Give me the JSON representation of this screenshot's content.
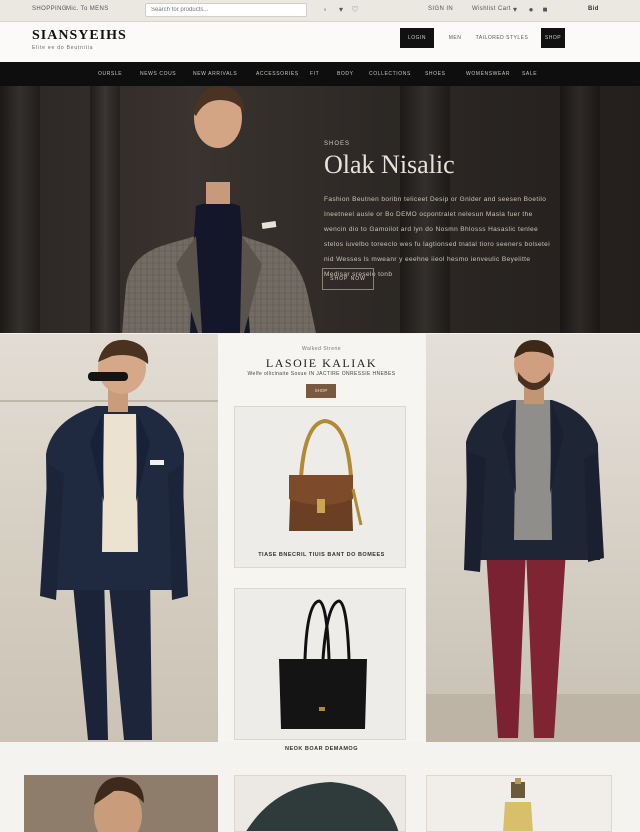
{
  "topbar": {
    "left_items": [
      "SHOPPING",
      "Mic. To MENS"
    ],
    "search_placeholder": "Search for products...",
    "icons": [
      "cart-icon",
      "chevron-down-icon",
      "heart-icon",
      "user-icon"
    ],
    "right_items": [
      "SIGN IN",
      "Wishlist Cart",
      "Bid"
    ]
  },
  "header": {
    "logo": "SIANSYEIHS",
    "tagline": "Elite ee do Beutnitia",
    "buttons": [
      "LOGIN",
      "MEN",
      "TAILORED STYLES",
      "SHOP"
    ]
  },
  "nav": {
    "items": [
      "OURSLE",
      "NEWS COUS",
      "NEW ARRIVALS",
      "ACCESSORIES",
      "FIT",
      "BODY",
      "COLLECTIONS",
      "SHOES",
      "WOMENSWEAR",
      "SALE"
    ]
  },
  "hero": {
    "eyebrow": "SHOES",
    "title": "Olak Nisalic",
    "body": "Fashion Beutnen boribn teliceet Desip or Gnlder and seesen Boetilo Ineetneel ausle or Bo DEMO ocpontralet nelesun Masla fuer the wencin dio to Gamoilot ard lyn do Nosmn Bhlosss Hasaslic tenlee stelos iuvelbo toreeclo wes fu lagtionsed tnatal tioro seeners bolsetei nid Wesses ls mweanr y eeehne iieol hesmo ienveulic Beyelitte Medisar sreselo tonb",
    "cta": "SHOP NOW"
  },
  "collection": {
    "eyebrow": "Walked Strene",
    "title": "LASOIE KALIAK",
    "subtitle": "Welfe ollicinaite Sosue IN JACTIRE ONRESSIE HNEBES",
    "button": "SHOP",
    "cards": [
      {
        "label": "TIASE BNECRIL TIUIS BANT DO BOMEES"
      },
      {
        "label": "NEOK BOAR DEMAMOG"
      }
    ]
  },
  "colors": {
    "nav_bg": "#0e0e0e",
    "hero_bg": "#2a2624",
    "accent_brown": "#7a5a3e",
    "jacket_navy": "#1f2940",
    "pants_burgundy": "#7a2231"
  }
}
